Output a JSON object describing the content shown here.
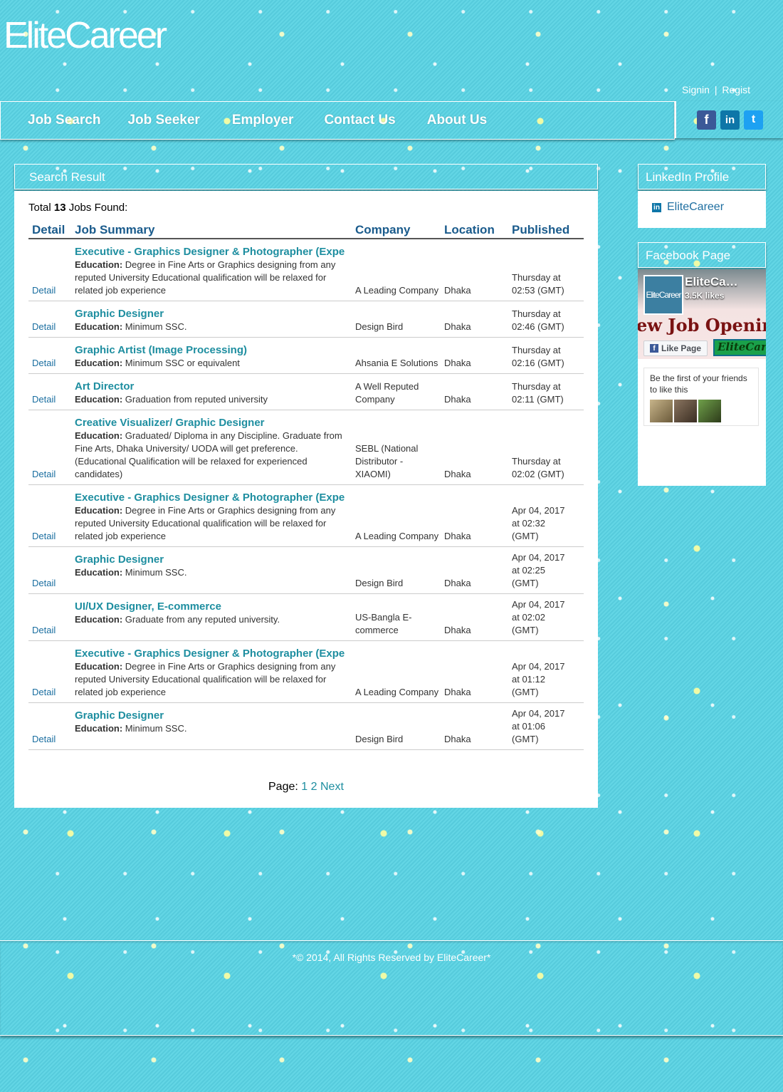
{
  "brand": {
    "logo_text": "EliteCareer"
  },
  "top_links": {
    "signin": "Signin",
    "separator": "|",
    "register": "Regist"
  },
  "nav": {
    "items": [
      "Job Search",
      "Job Seeker",
      "Employer",
      "Contact Us",
      "About Us"
    ]
  },
  "social": {
    "facebook": "f",
    "linkedin": "in",
    "twitter": "t"
  },
  "search_result": {
    "heading": "Search Result",
    "total_prefix": "Total ",
    "total_count": "13",
    "total_suffix": " Jobs Found:",
    "columns": [
      "Detail",
      "Job Summary",
      "Company",
      "Location",
      "Published"
    ],
    "edu_label": "Education:",
    "jobs": [
      {
        "detail": "Detail",
        "title": "Executive - Graphics Designer & Photographer (Expe",
        "education": "Degree in Fine Arts or Graphics designing from any reputed University Educational qualification will be relaxed for related job experience",
        "company": "A Leading Company",
        "location": "Dhaka",
        "published": "Thursday at 02:53 (GMT)"
      },
      {
        "detail": "Detail",
        "title": "Graphic Designer",
        "education": "Minimum SSC.",
        "company": "Design Bird",
        "location": "Dhaka",
        "published": "Thursday at 02:46 (GMT)"
      },
      {
        "detail": "Detail",
        "title": "Graphic Artist (Image Processing)",
        "education": "Minimum SSC or equivalent",
        "company": "Ahsania E Solutions",
        "location": "Dhaka",
        "published": "Thursday at 02:16 (GMT)"
      },
      {
        "detail": "Detail",
        "title": "Art Director",
        "education": "Graduation from reputed university",
        "company": "A Well Reputed Company",
        "location": "Dhaka",
        "published": "Thursday at 02:11 (GMT)"
      },
      {
        "detail": "Detail",
        "title": "Creative Visualizer/ Graphic Designer",
        "education": "Graduated/ Diploma in any Discipline. Graduate from Fine Arts, Dhaka University/ UODA will get preference. (Educational Qualification will be relaxed for experienced candidates)",
        "company": "SEBL (National Distributor - XIAOMI)",
        "location": "Dhaka",
        "published": "Thursday at 02:02 (GMT)"
      },
      {
        "detail": "Detail",
        "title": "Executive - Graphics Designer & Photographer (Expe",
        "education": "Degree in Fine Arts or Graphics designing from any reputed University Educational qualification will be relaxed for related job experience",
        "company": "A Leading Company",
        "location": "Dhaka",
        "published": "Apr 04, 2017 at 02:32 (GMT)"
      },
      {
        "detail": "Detail",
        "title": "Graphic Designer",
        "education": "Minimum SSC.",
        "company": "Design Bird",
        "location": "Dhaka",
        "published": "Apr 04, 2017 at 02:25 (GMT)"
      },
      {
        "detail": "Detail",
        "title": "UI/UX Designer, E-commerce",
        "education": "Graduate from any reputed university.",
        "company": "US-Bangla E-commerce",
        "location": "Dhaka",
        "published": "Apr 04, 2017 at 02:02 (GMT)"
      },
      {
        "detail": "Detail",
        "title": "Executive - Graphics Designer & Photographer (Expe",
        "education": "Degree in Fine Arts or Graphics designing from any reputed University Educational qualification will be relaxed for related job experience",
        "company": "A Leading Company",
        "location": "Dhaka",
        "published": "Apr 04, 2017 at 01:12 (GMT)"
      },
      {
        "detail": "Detail",
        "title": "Graphic Designer",
        "education": "Minimum SSC.",
        "company": "Design Bird",
        "location": "Dhaka",
        "published": "Apr 04, 2017 at 01:06 (GMT)"
      }
    ],
    "pager": {
      "label": "Page:",
      "pages": [
        "1",
        "2"
      ],
      "next": "Next"
    }
  },
  "linkedin_profile": {
    "heading": "LinkedIn Profile",
    "name": "EliteCareer"
  },
  "facebook_page": {
    "heading": "Facebook Page",
    "thumb_text": "EliteCareer",
    "page_name": "EliteCa…",
    "likes": "3.5K likes",
    "banner": "ew Job Openin",
    "like_button": "Like Page",
    "brand_badge": "EliteCar",
    "friends_text": "Be the first of your friends to like this"
  },
  "footer": {
    "text": "*© 2014, All Rights Reserved by EliteCareer*"
  }
}
